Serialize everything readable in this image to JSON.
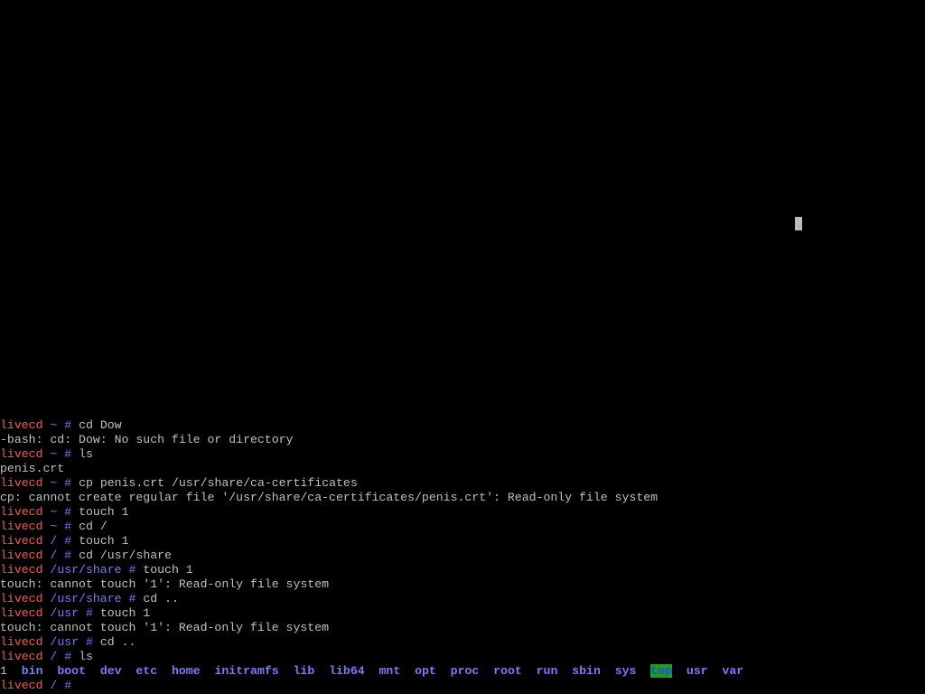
{
  "colors": {
    "background": "#000000",
    "text": "#c0c0c0",
    "host": "#ff5555",
    "path": "#7a7aff",
    "sticky_dir_bg": "#14a514"
  },
  "terminal": {
    "lines": [
      {
        "type": "prompt",
        "host": "livecd",
        "path": "~",
        "hash": "#",
        "cmd": "cd Dow"
      },
      {
        "type": "output",
        "text": "-bash: cd: Dow: No such file or directory"
      },
      {
        "type": "prompt",
        "host": "livecd",
        "path": "~",
        "hash": "#",
        "cmd": "ls"
      },
      {
        "type": "output",
        "text": "penis.crt"
      },
      {
        "type": "prompt",
        "host": "livecd",
        "path": "~",
        "hash": "#",
        "cmd": "cp penis.crt /usr/share/ca-certificates"
      },
      {
        "type": "output",
        "text": "cp: cannot create regular file '/usr/share/ca-certificates/penis.crt': Read-only file system"
      },
      {
        "type": "prompt",
        "host": "livecd",
        "path": "~",
        "hash": "#",
        "cmd": "touch 1"
      },
      {
        "type": "prompt",
        "host": "livecd",
        "path": "~",
        "hash": "#",
        "cmd": "cd /"
      },
      {
        "type": "prompt",
        "host": "livecd",
        "path": "/",
        "hash": "#",
        "cmd": "touch 1"
      },
      {
        "type": "prompt",
        "host": "livecd",
        "path": "/",
        "hash": "#",
        "cmd": "cd /usr/share"
      },
      {
        "type": "prompt",
        "host": "livecd",
        "path": "/usr/share",
        "hash": "#",
        "cmd": "touch 1"
      },
      {
        "type": "output",
        "text": "touch: cannot touch '1': Read-only file system"
      },
      {
        "type": "prompt",
        "host": "livecd",
        "path": "/usr/share",
        "hash": "#",
        "cmd": "cd .."
      },
      {
        "type": "prompt",
        "host": "livecd",
        "path": "/usr",
        "hash": "#",
        "cmd": "touch 1"
      },
      {
        "type": "output",
        "text": "touch: cannot touch '1': Read-only file system"
      },
      {
        "type": "prompt",
        "host": "livecd",
        "path": "/usr",
        "hash": "#",
        "cmd": "cd .."
      },
      {
        "type": "prompt",
        "host": "livecd",
        "path": "/",
        "hash": "#",
        "cmd": "ls"
      },
      {
        "type": "listing",
        "entries": [
          {
            "name": "1",
            "kind": "file"
          },
          {
            "name": "bin",
            "kind": "dir"
          },
          {
            "name": "boot",
            "kind": "dir"
          },
          {
            "name": "dev",
            "kind": "dir"
          },
          {
            "name": "etc",
            "kind": "dir"
          },
          {
            "name": "home",
            "kind": "dir"
          },
          {
            "name": "initramfs",
            "kind": "dir"
          },
          {
            "name": "lib",
            "kind": "dir"
          },
          {
            "name": "lib64",
            "kind": "dir"
          },
          {
            "name": "mnt",
            "kind": "dir"
          },
          {
            "name": "opt",
            "kind": "dir"
          },
          {
            "name": "proc",
            "kind": "dir"
          },
          {
            "name": "root",
            "kind": "dir"
          },
          {
            "name": "run",
            "kind": "dir"
          },
          {
            "name": "sbin",
            "kind": "dir"
          },
          {
            "name": "sys",
            "kind": "dir"
          },
          {
            "name": "tmp",
            "kind": "sticky-dir"
          },
          {
            "name": "usr",
            "kind": "dir"
          },
          {
            "name": "var",
            "kind": "dir"
          }
        ]
      },
      {
        "type": "prompt",
        "host": "livecd",
        "path": "/",
        "hash": "#",
        "cmd": ""
      }
    ]
  }
}
